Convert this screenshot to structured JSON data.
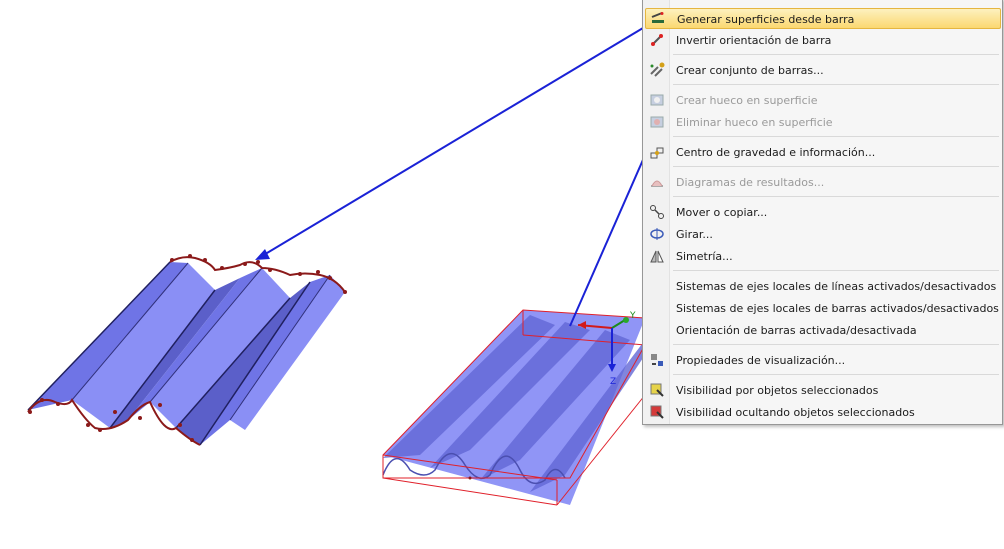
{
  "scene": {
    "left_model": "perforated corrugated surface panel",
    "right_model": "corrugated sheet in selection box",
    "axis": {
      "y_label": "Y",
      "z_label": "Z"
    },
    "colors": {
      "surface": "#7f84f2",
      "surface_dark": "#5356b8",
      "edge_nodes": "#8b1a1a",
      "selection_box": "#e0202a",
      "arrow": "#1a22d6"
    }
  },
  "menu": {
    "items": [
      {
        "label": "Generar superficies desde barra",
        "icon": "beam-to-surface-icon",
        "state": "hover"
      },
      {
        "label": "Invertir orientación de barra",
        "icon": "invert-beam-icon",
        "state": "normal"
      },
      {
        "label": "Crear conjunto de barras...",
        "icon": "beam-set-icon",
        "state": "normal"
      },
      {
        "label": "Crear hueco en superficie",
        "icon": "create-hole-icon",
        "state": "disabled"
      },
      {
        "label": "Eliminar hueco en superficie",
        "icon": "delete-hole-icon",
        "state": "disabled"
      },
      {
        "label": "Centro de gravedad e información...",
        "icon": "center-of-gravity-icon",
        "state": "normal"
      },
      {
        "label": "Diagramas de resultados...",
        "icon": "result-diagram-icon",
        "state": "disabled"
      },
      {
        "label": "Mover o copiar...",
        "icon": "move-copy-icon",
        "state": "normal"
      },
      {
        "label": "Girar...",
        "icon": "rotate-icon",
        "state": "normal"
      },
      {
        "label": "Simetría...",
        "icon": "mirror-icon",
        "state": "normal"
      },
      {
        "label": "Sistemas de ejes locales de líneas activados/desactivados",
        "icon": "",
        "state": "normal"
      },
      {
        "label": "Sistemas de ejes locales de barras activados/desactivados",
        "icon": "",
        "state": "normal"
      },
      {
        "label": "Orientación de barras activada/desactivada",
        "icon": "",
        "state": "normal"
      },
      {
        "label": "Propiedades de visualización...",
        "icon": "display-properties-icon",
        "state": "normal"
      },
      {
        "label": "Visibilidad por objetos seleccionados",
        "icon": "visibility-selected-icon",
        "state": "normal"
      },
      {
        "label": "Visibilidad ocultando objetos seleccionados",
        "icon": "visibility-hide-selected-icon",
        "state": "normal"
      }
    ]
  }
}
